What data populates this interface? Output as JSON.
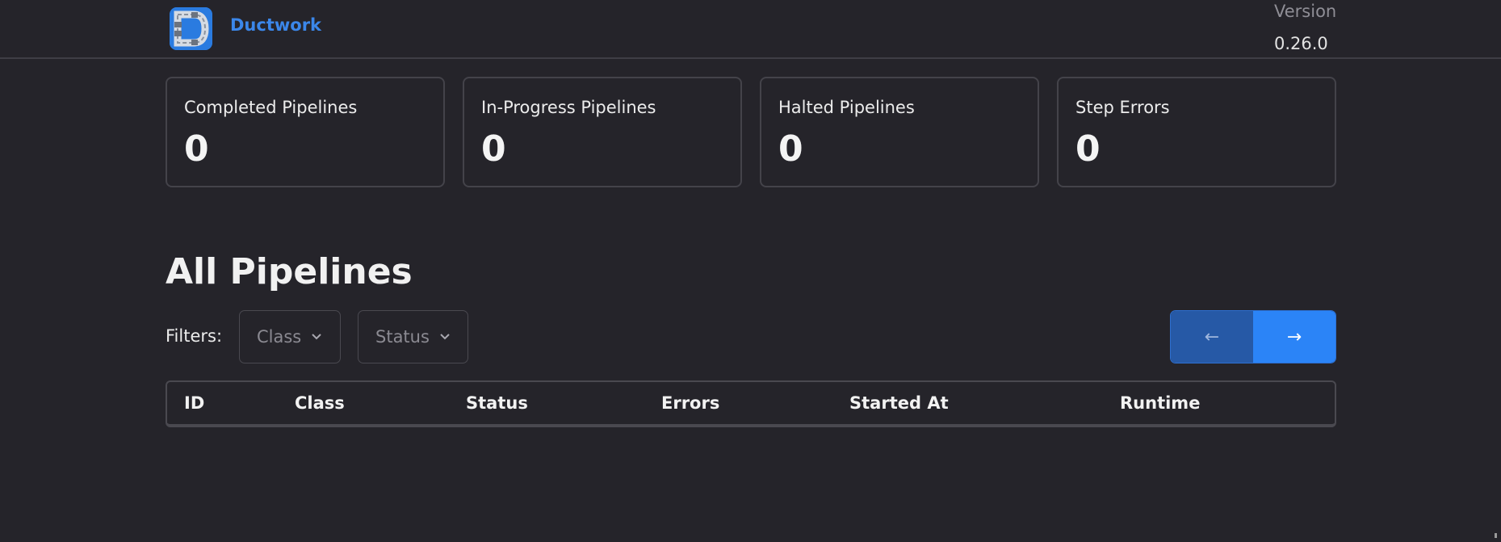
{
  "header": {
    "brand": "Ductwork",
    "version_label": "Version",
    "version_value": "0.26.0",
    "logo_icon": "ductwork-d-logo-icon"
  },
  "stats": [
    {
      "label": "Completed Pipelines",
      "value": "0"
    },
    {
      "label": "In-Progress Pipelines",
      "value": "0"
    },
    {
      "label": "Halted Pipelines",
      "value": "0"
    },
    {
      "label": "Step Errors",
      "value": "0"
    }
  ],
  "pipelines": {
    "title": "All Pipelines",
    "filters_label": "Filters:",
    "filters": [
      {
        "label": "Class",
        "icon": "chevron-down-icon"
      },
      {
        "label": "Status",
        "icon": "chevron-down-icon"
      }
    ],
    "pager": {
      "prev": "←",
      "next": "→"
    },
    "columns": [
      "ID",
      "Class",
      "Status",
      "Errors",
      "Started At",
      "Runtime"
    ]
  },
  "colors": {
    "background": "#25242a",
    "brand": "#3b87ea",
    "pager_prev": "#2659a6",
    "pager_next": "#2b84f7"
  }
}
